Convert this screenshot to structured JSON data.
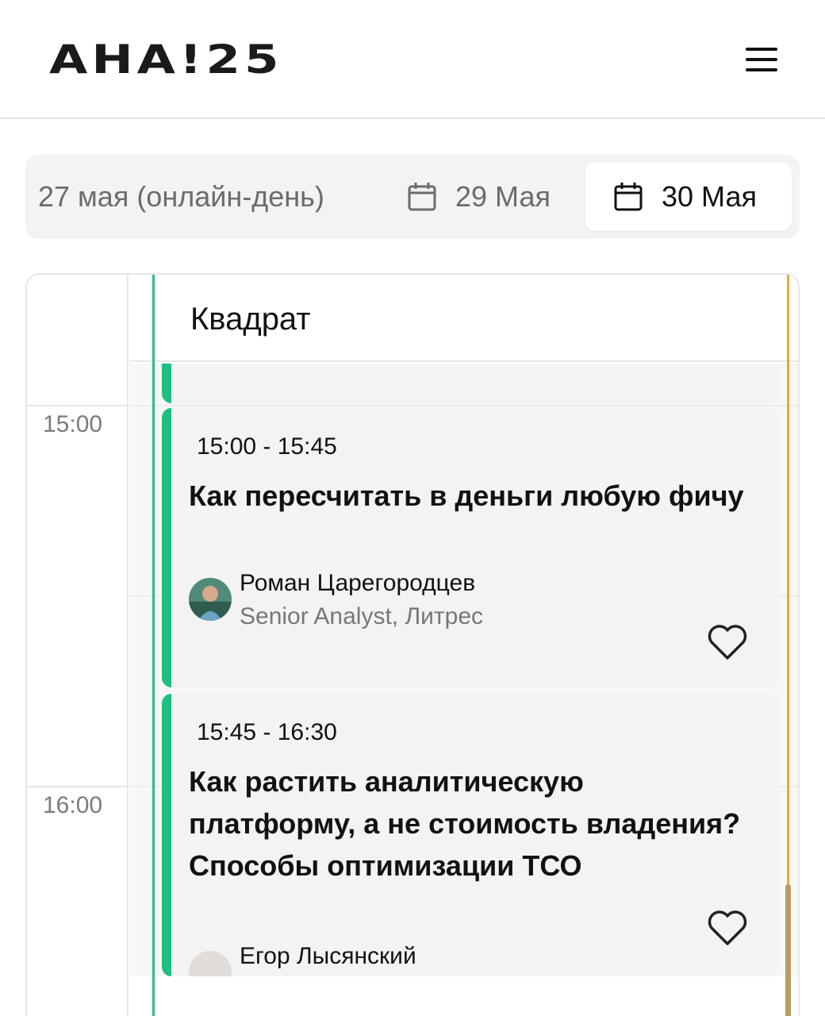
{
  "header": {
    "logo_text": "AHA!25",
    "menu_icon": "hamburger-menu-icon"
  },
  "tabs": [
    {
      "label": "27 мая (онлайн-день)",
      "icon": null,
      "active": false
    },
    {
      "label": "29 Мая",
      "icon": "calendar-icon",
      "active": false
    },
    {
      "label": "30 Мая",
      "icon": "calendar-icon",
      "active": true
    }
  ],
  "schedule": {
    "room": "Квадрат",
    "times": [
      "15:00",
      "16:00"
    ],
    "sessions": [
      {
        "time": "15:00 - 15:45",
        "title": "Как пересчитать в деньги любую фичу",
        "speaker_name": "Роман Царегородцев",
        "speaker_role": "Senior Analyst, Литрес"
      },
      {
        "time": "15:45 - 16:30",
        "title": "Как растить аналитическую платформу, а не стоимость владения? Способы оптимизации ТСО",
        "speaker_name": "Егор Лысянский",
        "speaker_role": ""
      }
    ]
  },
  "colors": {
    "accent_green": "#1fc07f",
    "track_orange": "#e3a93a",
    "tab_bg": "#f3f3f4"
  }
}
